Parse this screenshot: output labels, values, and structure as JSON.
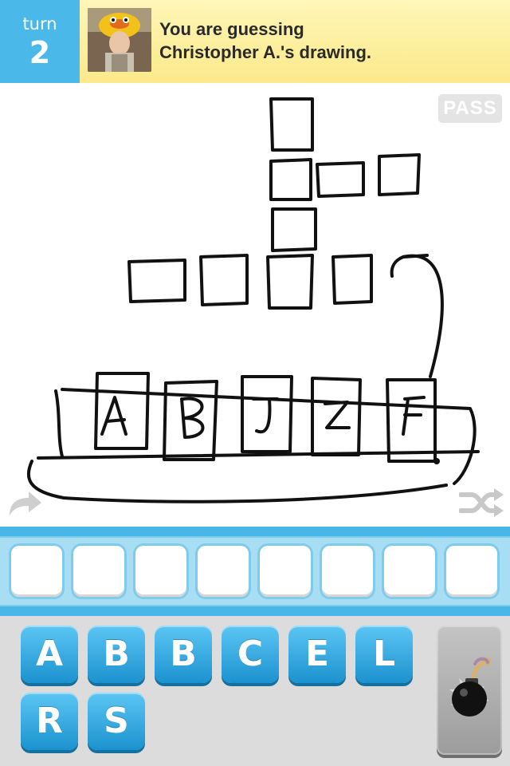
{
  "header": {
    "turn_label": "turn",
    "turn_number": "2",
    "message_line1": "You are guessing",
    "message_line2": "Christopher A.'s drawing."
  },
  "canvas": {
    "pass_label": "PASS",
    "drawn_letters": [
      "A",
      "B",
      "J",
      "Z",
      "F"
    ],
    "icons": {
      "replay": "replay-arrow-icon",
      "shuffle": "shuffle-icon"
    }
  },
  "answer": {
    "slot_count": 8,
    "slots": [
      "",
      "",
      "",
      "",
      "",
      "",
      "",
      ""
    ]
  },
  "keyboard": {
    "row1": [
      "A",
      "B",
      "B",
      "C",
      "E",
      "L"
    ],
    "row2": [
      "R",
      "S"
    ],
    "bomb": "bomb-icon"
  },
  "colors": {
    "accent": "#4ab8e8",
    "header_bg": "#fbe98a",
    "key_blue": "#1b92cf",
    "keyboard_bg": "#dcdcdc"
  }
}
